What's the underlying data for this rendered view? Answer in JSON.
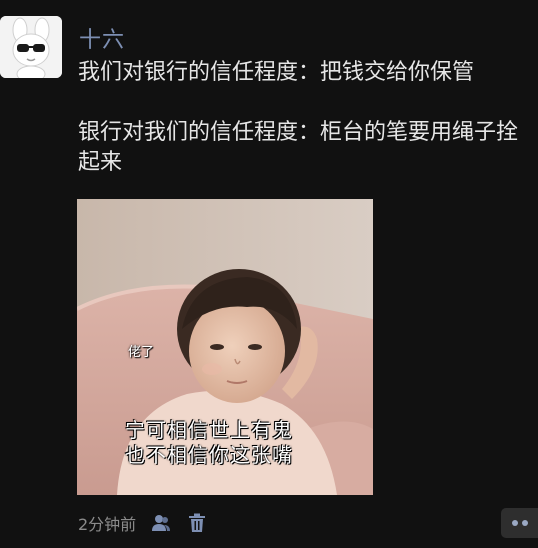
{
  "post": {
    "username": "十六",
    "lines": [
      "我们对银行的信任程度：把钱交给你保管",
      "银行对我们的信任程度：柜台的笔要用绳子拴起来"
    ],
    "image": {
      "caption_small": "佬了",
      "caption_line1": "宁可相信世上有鬼",
      "caption_line2": "也不相信你这张嘴"
    },
    "time": "2分钟前",
    "icons": {
      "avatar": "white-rabbit-sunglasses-avatar",
      "visibility": "people-icon",
      "delete": "trash-icon",
      "more": "more-dots-icon"
    },
    "colors": {
      "background": "#111111",
      "username": "#7d8fb3",
      "text": "#e6e6e6",
      "meta": "#8b8b8b"
    }
  }
}
